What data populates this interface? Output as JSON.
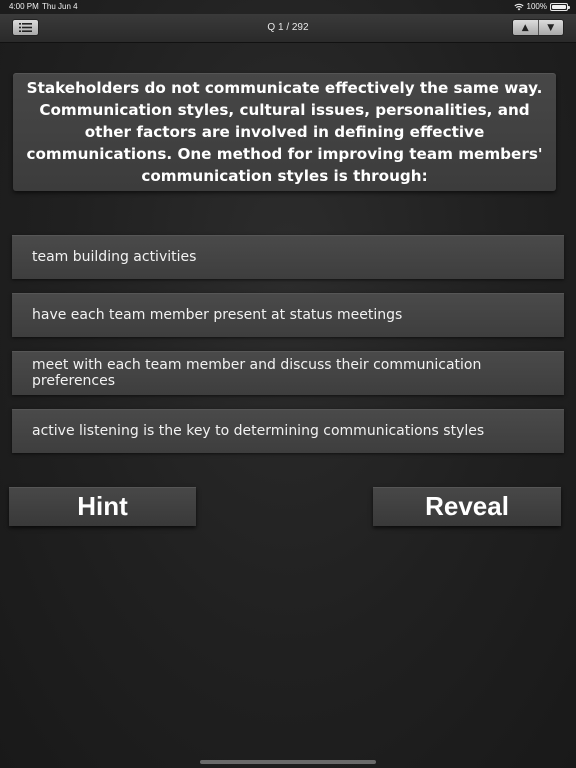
{
  "status_bar": {
    "time": "4:00 PM",
    "date": "Thu Jun 4",
    "battery": "100%",
    "battery_level": 1.0
  },
  "nav": {
    "title": "Q 1 / 292",
    "menu_icon": "list-icon",
    "up_icon": "triangle-up-icon",
    "down_icon": "triangle-down-icon",
    "up_glyph": "▲",
    "down_glyph": "▼"
  },
  "question": {
    "text": "Stakeholders do not communicate effectively the same way. Communication styles, cultural issues, personalities, and other factors are involved in defining effective communications. One method for improving team members' communication styles is through:"
  },
  "answers": [
    {
      "label": "team building activities"
    },
    {
      "label": "have each team member present at status meetings"
    },
    {
      "label": "meet with each team member and discuss their communication preferences"
    },
    {
      "label": "active listening is the key to determining communications styles"
    }
  ],
  "actions": {
    "hint_label": "Hint",
    "reveal_label": "Reveal"
  },
  "colors": {
    "background": "#1e1e1e",
    "card": "#444444",
    "text": "#ffffff"
  }
}
